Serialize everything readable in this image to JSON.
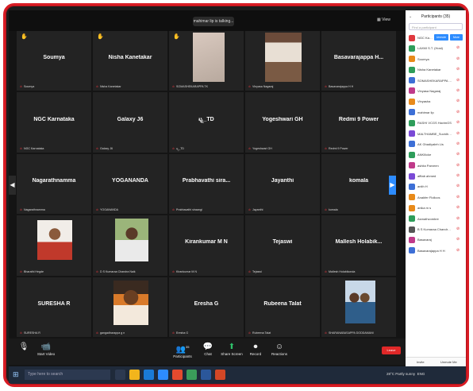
{
  "top": {
    "talking": "mahimar lip is talking...",
    "view": "View"
  },
  "tiles": [
    {
      "big": "Soumya",
      "small": "Soumya",
      "hand": true
    },
    {
      "big": "Nisha Kanetakar",
      "small": "Nisha Kanetakar",
      "hand": true
    },
    {
      "big": "",
      "small": "SOMASHEKARAPPA TK",
      "hand": true,
      "photo": "wall"
    },
    {
      "big": "",
      "small": "Vinyasa Nagaraj",
      "hand": false,
      "photo": "room"
    },
    {
      "big": "Basavarajappa H...",
      "small": "Basavarajappa H H",
      "hand": false
    },
    {
      "big": "NGC Karnataka",
      "small": "NGC Karnataka",
      "hand": false
    },
    {
      "big": "Galaxy J6",
      "small": "Galaxy J6",
      "hand": false
    },
    {
      "big": "ಟ್ಟ್ಟ_TD",
      "small": "ಟ್ಟ್ಟ_TD",
      "hand": false
    },
    {
      "big": "Yogeshwari GH",
      "small": "Yogeshwari GH",
      "hand": false
    },
    {
      "big": "Redmi 9 Power",
      "small": "Redmi 9 Power",
      "hand": false
    },
    {
      "big": "Nagarathnamma",
      "small": "Nagarathnamma",
      "hand": false
    },
    {
      "big": "YOGANANDA",
      "small": "YOGANANDA",
      "hand": false
    },
    {
      "big": "Prabhavathi sira...",
      "small": "Prabhavathi siraangi",
      "hand": false
    },
    {
      "big": "Jayanthi",
      "small": "Jayanthi",
      "hand": false
    },
    {
      "big": "komala",
      "small": "komala",
      "hand": false
    },
    {
      "big": "",
      "small": "Bharathi Hegde",
      "hand": false,
      "photo": "woman"
    },
    {
      "big": "",
      "small": "D S Kumaraa Chandra Naik",
      "hand": false,
      "photo": "man"
    },
    {
      "big": "Kirankumar M N",
      "small": "Kirankumar M N",
      "hand": false
    },
    {
      "big": "Tejaswi",
      "small": "Tejaswi",
      "hand": false
    },
    {
      "big": "Mallesh Holabik...",
      "small": "Mallesh Holabikonda",
      "hand": false
    },
    {
      "big": "SURESHA R",
      "small": "SURESHA R",
      "hand": false
    },
    {
      "big": "",
      "small": "gangadharappa g n",
      "hand": false,
      "photo": "portrait"
    },
    {
      "big": "Eresha G",
      "small": "Eresha G",
      "hand": false
    },
    {
      "big": "Rubeena Talat",
      "small": "Rubeena Talat",
      "hand": false
    },
    {
      "big": "",
      "small": "SHARANABASAPPA DODDAMANI",
      "hand": false,
      "photo": "group"
    }
  ],
  "toolbar": {
    "video": "Start Video",
    "participants": "Participants",
    "chat": "Chat",
    "share": "Share Screen",
    "record": "Record",
    "reactions": "Reactions",
    "end": "Leave",
    "participants_count": "35"
  },
  "panel": {
    "title": "Participants (35)",
    "search": "Find a participant",
    "unmute": "Unmute",
    "more": "More",
    "invite": "Invite",
    "unmute_me": "Unmute Me",
    "rows": [
      {
        "name": "NGC Kar... (Host, me)",
        "color": "#e0393e"
      },
      {
        "name": "LAXMI S.T. (Host)",
        "color": "#2e9d5a"
      },
      {
        "name": "Soumya",
        "color": "#e88a1a"
      },
      {
        "name": "Nisha Kanetakar",
        "color": "#2e9d5a"
      },
      {
        "name": "SOMASHEKARAPPA TK",
        "color": "#3d6fd6"
      },
      {
        "name": "Vinyasa Nagaraj",
        "color": "#c03a8a"
      },
      {
        "name": "Vinyasha",
        "color": "#e88a1a"
      },
      {
        "name": "mahimar lip",
        "color": "#3d6fd6"
      },
      {
        "name": "RASHI VCGS HavimGS",
        "color": "#2e9d5a"
      },
      {
        "name": "MALTHAMBE_Suvidhu/Jk2kMk",
        "color": "#7a4ad6"
      },
      {
        "name": "AK Ghadiyaleh Lis",
        "color": "#3d6fd6"
      },
      {
        "name": "ANKIlicke",
        "color": "#2e9d5a"
      },
      {
        "name": "ashita Parveen",
        "color": "#c03a8a"
      },
      {
        "name": "afftab ahmed",
        "color": "#7a4ad6"
      },
      {
        "name": "anith H",
        "color": "#3d6fd6"
      },
      {
        "name": "Anakfer Flollcos",
        "color": "#e88a1a"
      },
      {
        "name": "anika m s",
        "color": "#e88a1a"
      },
      {
        "name": "Asmathvombre",
        "color": "#2e9d5a"
      },
      {
        "name": "B S Kumaraa Chandra Naik",
        "color": "#555555"
      },
      {
        "name": "Basavaraj",
        "color": "#c03a8a"
      },
      {
        "name": "Basavarajappa H H",
        "color": "#3d6fd6"
      }
    ]
  },
  "taskbar": {
    "search": "Type here to search",
    "weather": "28°C Partly sunny",
    "language": "ENG"
  }
}
